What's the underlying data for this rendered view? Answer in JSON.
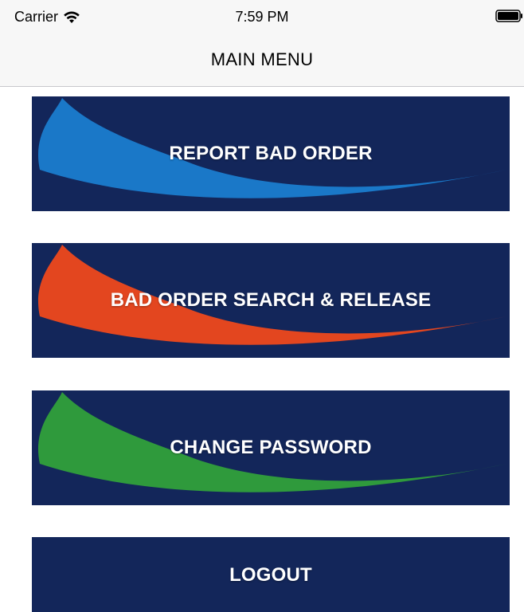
{
  "status_bar": {
    "carrier": "Carrier",
    "time": "7:59 PM",
    "icons": [
      "wifi-icon",
      "battery-icon"
    ]
  },
  "nav": {
    "title": "MAIN MENU"
  },
  "menu": {
    "items": [
      {
        "label": "REPORT BAD ORDER",
        "accent_color": "#1a78c8"
      },
      {
        "label": "BAD ORDER SEARCH & RELEASE",
        "accent_color": "#e3461f"
      },
      {
        "label": "CHANGE PASSWORD",
        "accent_color": "#2f9a3c"
      },
      {
        "label": "LOGOUT"
      }
    ],
    "background_color": "#13265a"
  }
}
